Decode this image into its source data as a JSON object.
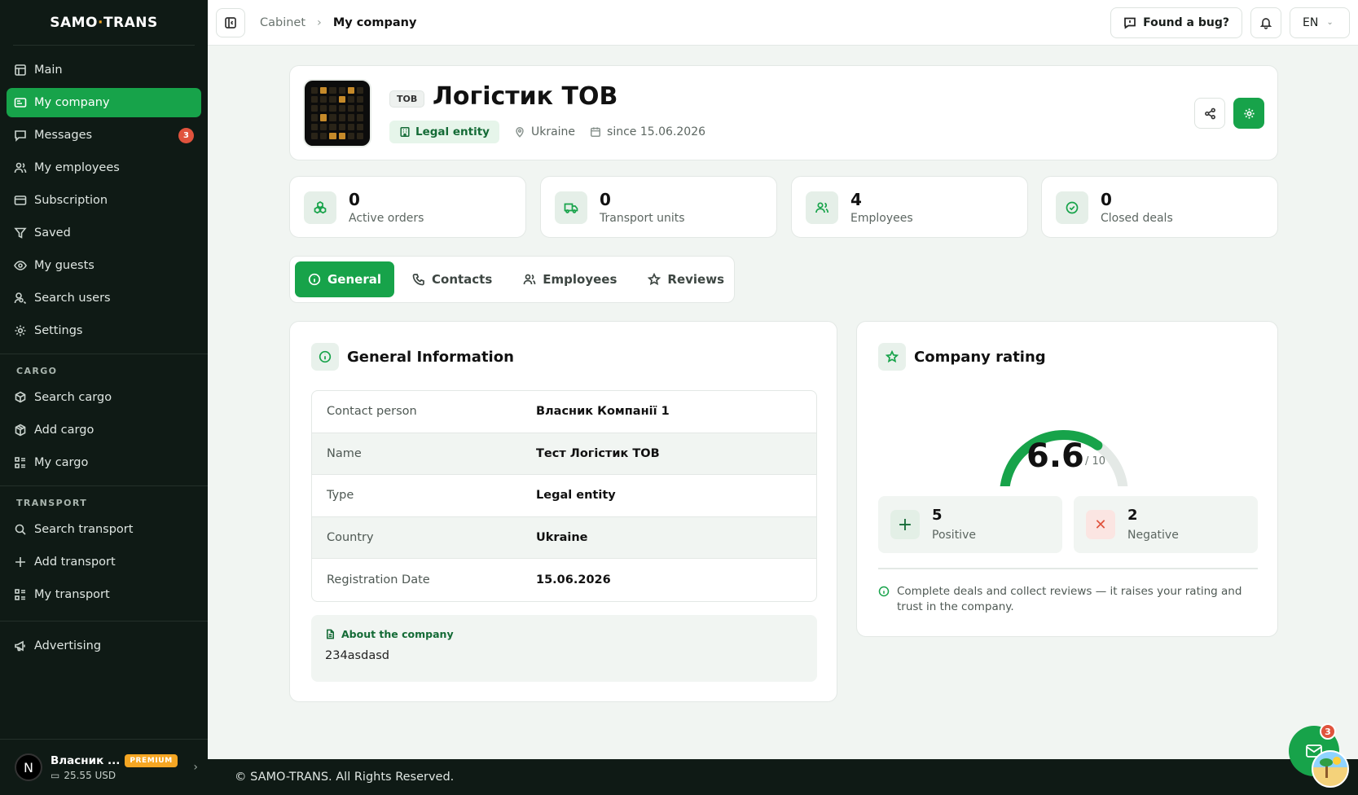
{
  "app": {
    "logo_left": "SAMO",
    "logo_dot": "·",
    "logo_right": "TRANS"
  },
  "sidebar": {
    "main_items": [
      {
        "label": "Main",
        "icon": "grid-icon"
      },
      {
        "label": "My company",
        "icon": "building-card-icon",
        "active": true
      },
      {
        "label": "Messages",
        "icon": "message-icon",
        "badge": "3"
      },
      {
        "label": "My employees",
        "icon": "users-icon"
      },
      {
        "label": "Subscription",
        "icon": "credit-card-icon"
      },
      {
        "label": "Saved",
        "icon": "filter-icon"
      },
      {
        "label": "My guests",
        "icon": "eye-icon"
      },
      {
        "label": "Search users",
        "icon": "user-search-icon"
      },
      {
        "label": "Settings",
        "icon": "gear-icon"
      }
    ],
    "cargo_title": "CARGO",
    "cargo_items": [
      {
        "label": "Search cargo",
        "icon": "search-cargo-icon"
      },
      {
        "label": "Add cargo",
        "icon": "box-icon"
      },
      {
        "label": "My cargo",
        "icon": "list-icon"
      }
    ],
    "transport_title": "TRANSPORT",
    "transport_items": [
      {
        "label": "Search transport",
        "icon": "search-icon"
      },
      {
        "label": "Add transport",
        "icon": "plus-icon"
      },
      {
        "label": "My transport",
        "icon": "list-icon"
      }
    ],
    "advertising": "Advertising",
    "user": {
      "initial": "N",
      "name": "Власник ...",
      "plan": "PREMIUM",
      "balance": "25.55 USD"
    }
  },
  "topbar": {
    "breadcrumb": [
      "Cabinet",
      "My company"
    ],
    "bug_label": "Found a bug?",
    "language": "EN"
  },
  "company": {
    "type_tag": "ТОВ",
    "title": "Логістик ТОВ",
    "entity": "Legal entity",
    "country": "Ukraine",
    "since": "since 15.06.2026"
  },
  "stats": [
    {
      "value": "0",
      "label": "Active orders",
      "icon": "boxes-icon"
    },
    {
      "value": "0",
      "label": "Transport units",
      "icon": "truck-icon"
    },
    {
      "value": "4",
      "label": "Employees",
      "icon": "users-icon"
    },
    {
      "value": "0",
      "label": "Closed deals",
      "icon": "check-circle-icon"
    }
  ],
  "tabs": [
    {
      "label": "General",
      "icon": "info-icon",
      "active": true
    },
    {
      "label": "Contacts",
      "icon": "phone-icon"
    },
    {
      "label": "Employees",
      "icon": "users-icon"
    },
    {
      "label": "Reviews",
      "icon": "star-icon"
    }
  ],
  "general": {
    "title": "General Information",
    "rows": [
      {
        "key": "Contact person",
        "value": "Власник Компанії 1"
      },
      {
        "key": "Name",
        "value": "Тест Логістик ТОВ"
      },
      {
        "key": "Type",
        "value": "Legal entity"
      },
      {
        "key": "Country",
        "value": "Ukraine"
      },
      {
        "key": "Registration Date",
        "value": "15.06.2026"
      }
    ],
    "about_title": "About the company",
    "about_text": "234asdasd"
  },
  "rating": {
    "title": "Company rating",
    "value": "6.6",
    "max": "/ 10",
    "score": 6.6,
    "score_max": 10,
    "positive": {
      "value": "5",
      "label": "Positive"
    },
    "negative": {
      "value": "2",
      "label": "Negative"
    },
    "note": "Complete deals and collect reviews — it raises your rating and trust in the company."
  },
  "footer": {
    "copyright": "© SAMO-TRANS. All Rights Reserved."
  },
  "chat": {
    "badge": "3"
  },
  "colors": {
    "accent": "#17a34a",
    "sidebar_bg": "#0f1a15",
    "danger": "#e0533d",
    "premium": "#f5a623"
  }
}
